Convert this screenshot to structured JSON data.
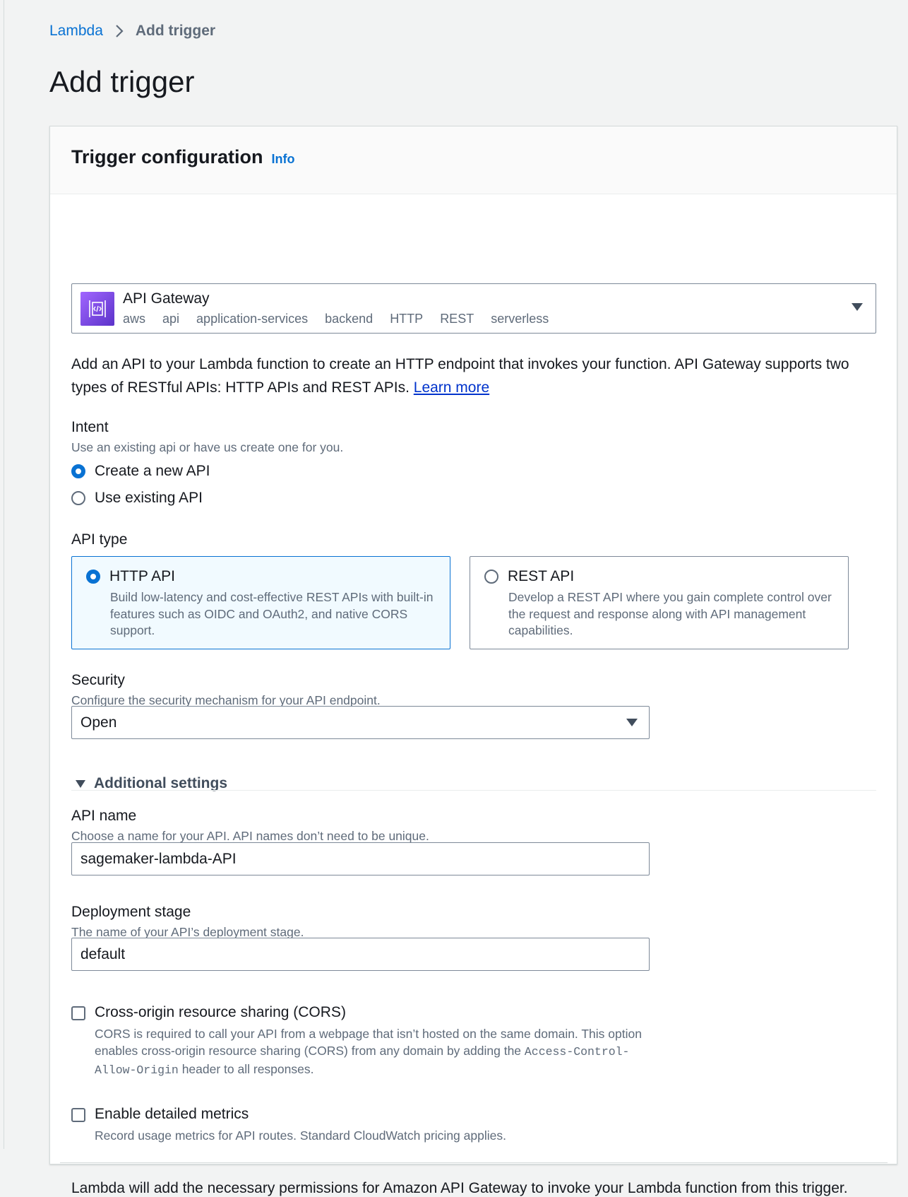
{
  "breadcrumb": {
    "root": "Lambda",
    "current": "Add trigger"
  },
  "page": {
    "title": "Add trigger"
  },
  "panel": {
    "title": "Trigger configuration",
    "info_link": "Info"
  },
  "service": {
    "name": "API Gateway",
    "tags": [
      "aws",
      "api",
      "application-services",
      "backend",
      "HTTP",
      "REST",
      "serverless"
    ],
    "icon": "api-gateway-icon",
    "icon_color": "#7b3fe4"
  },
  "description": {
    "text": "Add an API to your Lambda function to create an HTTP endpoint that invokes your function. API Gateway supports two types of RESTful APIs: HTTP APIs and REST APIs.",
    "link": "Learn more"
  },
  "intent": {
    "label": "Intent",
    "description": "Use an existing api or have us create one for you.",
    "options": [
      {
        "label": "Create a new API",
        "selected": true
      },
      {
        "label": "Use existing API",
        "selected": false
      }
    ]
  },
  "api_type": {
    "label": "API type",
    "options": [
      {
        "title": "HTTP API",
        "description": "Build low-latency and cost-effective REST APIs with built-in features such as OIDC and OAuth2, and native CORS support.",
        "selected": true
      },
      {
        "title": "REST API",
        "description": "Develop a REST API where you gain complete control over the request and response along with API management capabilities.",
        "selected": false
      }
    ]
  },
  "security": {
    "label": "Security",
    "description": "Configure the security mechanism for your API endpoint.",
    "value": "Open"
  },
  "additional_settings": {
    "label": "Additional settings",
    "expanded": true
  },
  "api_name": {
    "label": "API name",
    "description": "Choose a name for your API. API names don’t need to be unique.",
    "value": "sagemaker-lambda-API"
  },
  "deployment_stage": {
    "label": "Deployment stage",
    "description": "The name of your API’s deployment stage.",
    "value": "default"
  },
  "cors": {
    "label": "Cross-origin resource sharing (CORS)",
    "description_before": "CORS is required to call your API from a webpage that isn’t hosted on the same domain. This option enables cross-origin resource sharing (CORS) from any domain by adding the ",
    "header_code": "Access-Control-Allow-Origin",
    "description_after": " header to all responses.",
    "checked": false
  },
  "metrics": {
    "label": "Enable detailed metrics",
    "description": "Record usage metrics for API routes. Standard CloudWatch pricing applies.",
    "checked": false
  },
  "footer": {
    "text": "Lambda will add the necessary permissions for Amazon API Gateway to invoke your Lambda function from this trigger."
  },
  "colors": {
    "accent": "#0972d3",
    "link": "#0033cc",
    "selected_tile_bg": "#f1faff"
  }
}
